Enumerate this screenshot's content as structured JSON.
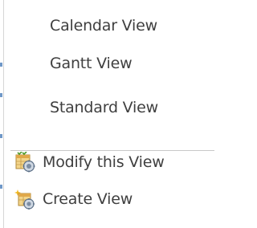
{
  "menu": {
    "view_items": [
      {
        "label": "Calendar View"
      },
      {
        "label": "Gantt View"
      },
      {
        "label": "Standard View"
      }
    ],
    "action_items": [
      {
        "label": "Modify this View",
        "icon": "modify-view-icon"
      },
      {
        "label": "Create View",
        "icon": "create-view-icon"
      }
    ]
  },
  "colors": {
    "text": "#3f3f3f",
    "separator": "#c8c8c8",
    "edge_accent": "#6f98c8"
  }
}
